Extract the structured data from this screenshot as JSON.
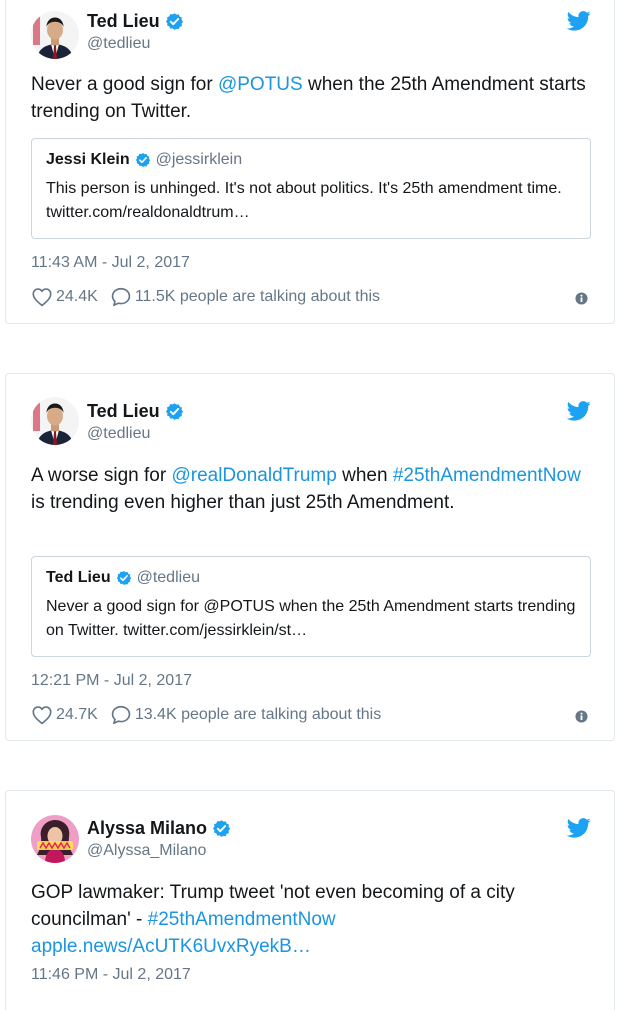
{
  "tweets": [
    {
      "author": {
        "name": "Ted Lieu",
        "handle": "@tedlieu"
      },
      "text_parts": [
        "Never a good sign for ",
        "@POTUS",
        " when the 25th Amendment starts trending on Twitter."
      ],
      "quote": {
        "name": "Jessi Klein",
        "handle": "@jessirklein",
        "text": "This person is unhinged. It's not about politics. It's 25th amendment time. twitter.com/realdonaldtrum…"
      },
      "timestamp": "11:43 AM - Jul 2, 2017",
      "likes": "24.4K",
      "talking": "11.5K people are talking about this"
    },
    {
      "author": {
        "name": "Ted Lieu",
        "handle": "@tedlieu"
      },
      "text_parts": [
        "A worse sign for ",
        "@realDonaldTrump",
        " when ",
        "#25thAmendmentNow",
        " is trending even higher than just 25th Amendment."
      ],
      "quote": {
        "name": "Ted Lieu",
        "handle": "@tedlieu",
        "text": "Never a good sign for @POTUS when the 25th Amendment starts trending on Twitter. twitter.com/jessirklein/st…"
      },
      "timestamp": "12:21 PM - Jul 2, 2017",
      "likes": "24.7K",
      "talking": "13.4K people are talking about this"
    },
    {
      "author": {
        "name": "Alyssa Milano",
        "handle": "@Alyssa_Milano"
      },
      "text_parts": [
        "GOP lawmaker: Trump tweet 'not even becoming of a city councilman' - ",
        "#25thAmendmentNow",
        " ",
        "apple.news/AcUTK6UvxRyekB…"
      ],
      "timestamp": "11:46 PM - Jul 2, 2017"
    }
  ],
  "colors": {
    "link": "#1b95e0",
    "verified": "#1da1f2",
    "muted": "#657786",
    "border": "#e1e8ed"
  },
  "icons": [
    "tedlieu-avatar",
    "alyssa-avatar",
    "verified-badge-icon",
    "twitter-bird-icon",
    "heart-icon",
    "speech-bubble-icon",
    "info-icon"
  ]
}
